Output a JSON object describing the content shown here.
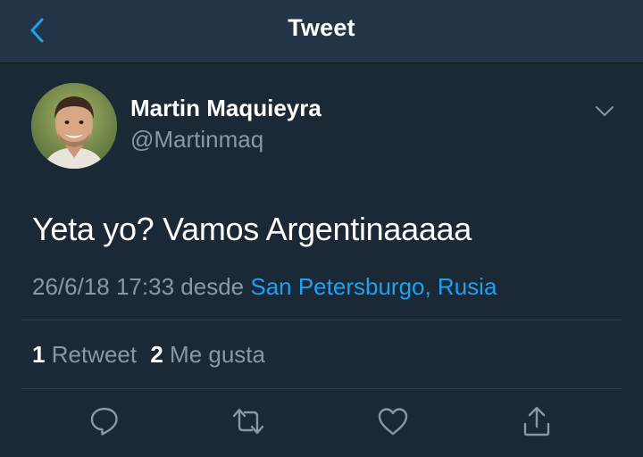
{
  "header": {
    "title": "Tweet",
    "back_icon": "chevron-left-icon"
  },
  "author": {
    "name": "Martin Maquieyra",
    "handle": "@Martinmaq"
  },
  "tweet": {
    "text": "Yeta yo? Vamos Argentinaaaaa",
    "timestamp": "26/6/18 17:33",
    "via_label": "desde",
    "location": "San Petersburgo, Rusia"
  },
  "stats": {
    "retweets_count": "1",
    "retweets_label": "Retweet",
    "likes_count": "2",
    "likes_label": "Me gusta"
  },
  "actions": [
    "reply-icon",
    "retweet-icon",
    "like-icon",
    "share-icon"
  ],
  "colors": {
    "background": "#1b2836",
    "nav_background": "#243447",
    "accent": "#1da1f2",
    "secondary_text": "#8899a6",
    "divider": "#38444d"
  }
}
